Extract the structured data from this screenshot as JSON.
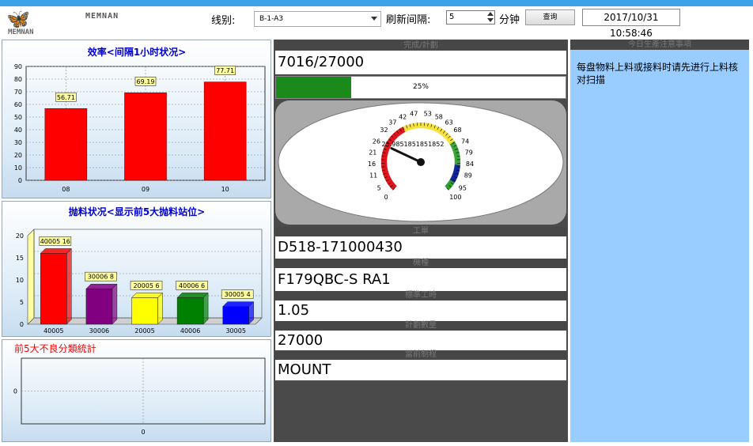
{
  "header": {
    "logo_mark": "🦋",
    "logo_brand": "MEMNAN",
    "logo_brand_sub": "MEMNAN",
    "line_label": "线别:",
    "line_value": "B-1-A3",
    "refresh_label": "刷新间隔:",
    "refresh_value": "5",
    "refresh_unit": "分钟",
    "query_button": "查询",
    "datetime": "2017/10/31 10:58:46"
  },
  "efficiency_chart": {
    "title": "效率<间隔1小时状况>",
    "chart_data": {
      "type": "bar",
      "categories": [
        "08",
        "09",
        "10"
      ],
      "values": [
        56.71,
        69.19,
        77.71
      ],
      "ylim": [
        0,
        90
      ],
      "yticks": [
        "0",
        "10",
        "20",
        "30",
        "40",
        "50",
        "60",
        "70",
        "80",
        "90"
      ],
      "color": "#ff0000",
      "grid": true
    }
  },
  "throw_chart": {
    "title": "抛料状况<显示前5大抛料站位>",
    "chart_data": {
      "type": "bar",
      "categories": [
        "40005",
        "30006",
        "20005",
        "40006",
        "30005"
      ],
      "values": [
        16,
        8,
        6,
        6,
        4
      ],
      "labels": [
        "40005 16",
        "30006 8",
        "20005 6",
        "40006 6",
        "30005 4"
      ],
      "colors": [
        "#ff0000",
        "#800080",
        "#ffff00",
        "#008000",
        "#0000ff"
      ],
      "ylim": [
        0,
        20
      ],
      "yticks": [
        "0",
        "5",
        "10",
        "15",
        "20"
      ],
      "grid": true
    }
  },
  "defect_chart": {
    "title": "前5大不良分類統計",
    "chart_data": {
      "type": "bar",
      "categories": [
        "0"
      ],
      "values": [],
      "yticks": [
        "0"
      ],
      "grid": true
    }
  },
  "completion": {
    "header": "完成/計劃",
    "value": "7016/27000",
    "progress_fraction": 0.2598,
    "progress_label": "25%",
    "gauge_value": 25.9851851851852,
    "gauge_readout": "25.9851851851852",
    "gauge_ticks": [
      "0",
      "5",
      "11",
      "16",
      "21",
      "26",
      "32",
      "37",
      "42",
      "47",
      "53",
      "58",
      "63",
      "68",
      "74",
      "79",
      "84",
      "89",
      "95",
      "100"
    ]
  },
  "fields": [
    {
      "label": "工單",
      "value": "D518-171000430"
    },
    {
      "label": "機種",
      "value": "F179QBC-S RA1"
    },
    {
      "label": "標準工時",
      "value": "1.05"
    },
    {
      "label": "計劃數量",
      "value": "27000"
    },
    {
      "label": "當前制程",
      "value": "MOUNT"
    }
  ],
  "notice": {
    "header": "今日生產注意事項",
    "text": "每盘物料上料或接料时请先进行上料核对扫描"
  }
}
